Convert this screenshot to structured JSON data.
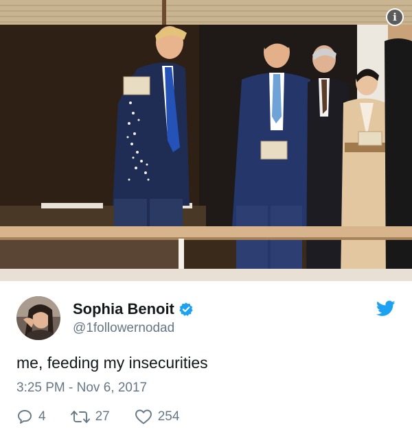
{
  "photo": {
    "info_icon": "info-icon",
    "colors": {
      "wall": "#3a2a1c",
      "railing": "#d7b48c",
      "suit_navy": "#1f2d55",
      "kimono": "#e3c7a1"
    }
  },
  "tweet": {
    "author": {
      "display_name": "Sophia Benoit",
      "handle": "@1followernodad",
      "verified_icon": "verified-badge-icon"
    },
    "brand_icon": "twitter-bird-icon",
    "text": "me, feeding my insecurities",
    "timestamp": "3:25 PM - Nov 6, 2017",
    "actions": {
      "reply_count": "4",
      "retweet_count": "27",
      "like_count": "254"
    },
    "colors": {
      "accent": "#1da1f2",
      "secondary_text": "#657786",
      "primary_text": "#14171a"
    }
  }
}
